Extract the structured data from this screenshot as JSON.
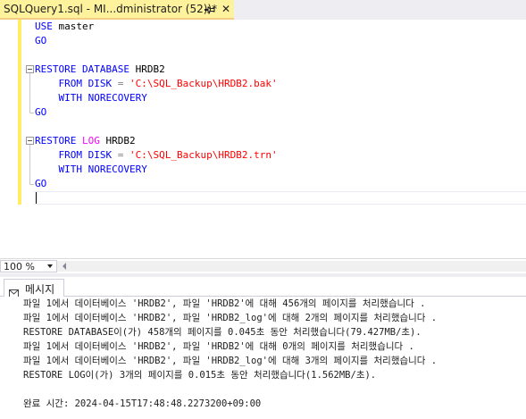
{
  "document_tab": {
    "title": "SQLQuery1.sql - MI...dministrator (52))*",
    "close_glyph": "✕"
  },
  "editor": {
    "lines": {
      "l1": {
        "use_kw": "USE",
        "db": " master"
      },
      "l2": {
        "go": "GO"
      },
      "l4": {
        "restore": "RESTORE",
        "database": "DATABASE",
        "name": " HRDB2"
      },
      "l5": {
        "from": "FROM",
        "disk": "DISK",
        "eq": " = ",
        "path": "'C:\\SQL_Backup\\HRDB2.bak'"
      },
      "l6": {
        "with": "WITH",
        "norecovery": "NORECOVERY"
      },
      "l7": {
        "go": "GO"
      },
      "l9": {
        "restore": "RESTORE",
        "log": "LOG",
        "name": " HRDB2"
      },
      "l10": {
        "from": "FROM",
        "disk": "DISK",
        "eq": " = ",
        "path": "'C:\\SQL_Backup\\HRDB2.trn'"
      },
      "l11": {
        "with": "WITH",
        "norecovery": "NORECOVERY"
      },
      "l12": {
        "go": "GO"
      }
    }
  },
  "zoom": {
    "value": "100 %"
  },
  "results": {
    "tab_label": "메시지",
    "messages": [
      "파일 1에서 데이터베이스 'HRDB2', 파일 'HRDB2'에 대해 456개의 페이지를 처리했습니다 .",
      "파일 1에서 데이터베이스 'HRDB2', 파일 'HRDB2_log'에 대해 2개의 페이지를 처리했습니다 .",
      "RESTORE DATABASE이(가) 458개의 페이지를 0.045초 동안 처리했습니다(79.427MB/초).",
      "파일 1에서 데이터베이스 'HRDB2', 파일 'HRDB2'에 대해 0개의 페이지를 처리했습니다 .",
      "파일 1에서 데이터베이스 'HRDB2', 파일 'HRDB2_log'에 대해 3개의 페이지를 처리했습니다 .",
      "RESTORE LOG이(가) 3개의 페이지를 0.015초 동안 처리했습니다(1.562MB/초).",
      "완료 시간: 2024-04-15T17:48:48.2273200+09:00"
    ]
  },
  "colors": {
    "keyword": "#0000ff",
    "string": "#ff0000",
    "operator": "#808080",
    "system_function": "#ff00ff",
    "active_tab": "#fff29d",
    "change_bar": "#ffee62"
  },
  "icons": {
    "pin": "pin-icon",
    "close": "close-icon",
    "collapse": "collapse-icon",
    "messages": "message-icon",
    "dropdown": "chevron-down-icon",
    "scroll_left": "scroll-left-arrow-icon"
  }
}
